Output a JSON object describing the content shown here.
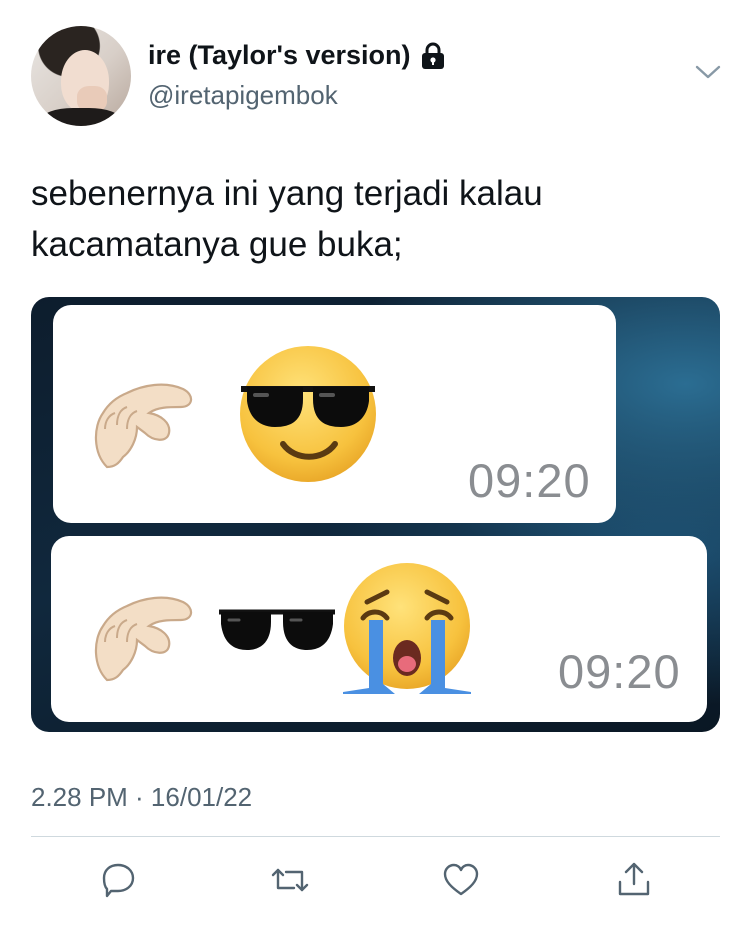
{
  "author": {
    "display_name": "ire (Taylor's version)",
    "handle": "@iretapigembok",
    "protected": true
  },
  "tweet": {
    "text": "sebenernya ini yang terjadi kalau kacamatanya gue buka;"
  },
  "media": {
    "messages": [
      {
        "emojis": [
          "pinching-hand",
          "smiling-face-with-sunglasses"
        ],
        "time": "09:20"
      },
      {
        "emojis": [
          "pinching-hand",
          "sunglasses",
          "loudly-crying-face"
        ],
        "time": "09:20"
      }
    ]
  },
  "meta": {
    "timestamp": "2.28 PM · 16/01/22"
  },
  "actions": [
    "reply-icon",
    "retweet-icon",
    "like-icon",
    "share-icon"
  ],
  "colors": {
    "text": "#0f1419",
    "secondary": "#536471",
    "divider": "#cfd9de",
    "emoji_yellow": "#f7c23e",
    "tear_blue": "#4a90e2"
  }
}
